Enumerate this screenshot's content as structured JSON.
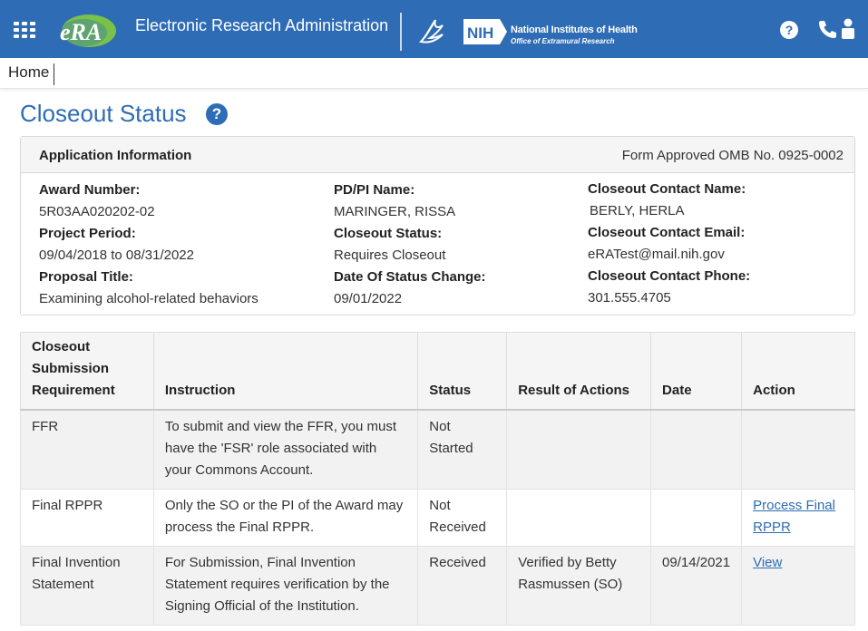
{
  "header": {
    "app_title": "Electronic Research Administration",
    "era_logo_text": "eRA",
    "nih_abbrev": "NIH",
    "nih_name": "National Institutes of Health",
    "nih_sub": "Office of Extramural Research",
    "help_icon": "?",
    "icons": [
      "apps-grid-icon",
      "hhs-eagle-icon",
      "help-icon",
      "phone-icon",
      "person-icon"
    ]
  },
  "nav": {
    "home": "Home"
  },
  "page": {
    "title": "Closeout Status",
    "title_help": "?"
  },
  "application_info": {
    "heading": "Application Information",
    "omb": "Form Approved OMB No. 0925-0002",
    "award_number_label": "Award Number:",
    "award_number": "5R03AA020202-02",
    "project_period_label": "Project Period:",
    "project_period": "09/04/2018 to 08/31/2022",
    "proposal_title_label": "Proposal Title:",
    "proposal_title": "Examining alcohol-related behaviors",
    "pi_label": "PD/PI Name:",
    "pi_name": "MARINGER, RISSA",
    "closeout_status_label": "Closeout Status:",
    "closeout_status": "Requires Closeout",
    "status_change_label": "Date Of Status Change:",
    "status_change_date": "09/01/2022",
    "contact_name_label": "Closeout Contact Name:",
    "contact_name": "BERLY, HERLA",
    "contact_email_label": "Closeout Contact Email:",
    "contact_email": "eRATest@mail.nih.gov",
    "contact_phone_label": "Closeout Contact Phone:",
    "contact_phone": "301.555.4705"
  },
  "table": {
    "headers": {
      "requirement": "Closeout Submission Requirement",
      "instruction": "Instruction",
      "status": "Status",
      "result": "Result of Actions",
      "date": "Date",
      "action": "Action"
    },
    "rows": [
      {
        "requirement": "FFR",
        "instruction": "To submit and view the FFR, you must have the 'FSR' role associated with your Commons Account.",
        "status": "Not Started",
        "result": "",
        "date": "",
        "action": ""
      },
      {
        "requirement": "Final RPPR",
        "instruction": "Only the SO or the PI of the Award may process the Final RPPR.",
        "status": "Not Received",
        "result": "",
        "date": "",
        "action": "Process Final RPPR"
      },
      {
        "requirement": "Final Invention Statement",
        "instruction": "For Submission, Final Invention Statement requires verification by the Signing Official of the Institution.",
        "status": "Received",
        "result": "Verified by Betty Rasmussen (SO)",
        "date": "09/14/2021",
        "action": "View"
      }
    ]
  },
  "colors": {
    "brand_blue": "#2e6cb5",
    "header_bg": "#2e6cb5",
    "row_shade": "#f2f2f2"
  }
}
